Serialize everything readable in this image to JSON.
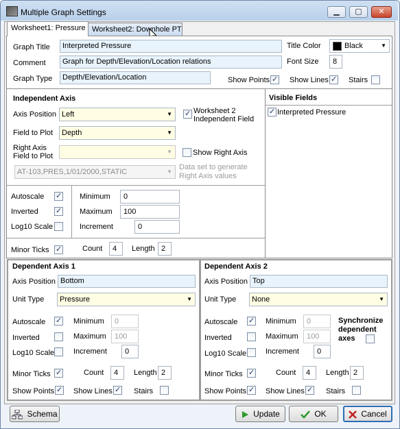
{
  "window": {
    "title": "Multiple Graph Settings",
    "min_label": "▁",
    "max_label": "▢",
    "close_label": "✕"
  },
  "tabs": [
    {
      "label": "Worksheet1: Pressure"
    },
    {
      "label": "Worksheet2: Downhole PT"
    }
  ],
  "graph": {
    "title_label": "Graph Title",
    "title_value": "Interpreted Pressure",
    "comment_label": "Comment",
    "comment_value": "Graph for Depth/Elevation/Location relations",
    "type_label": "Graph Type",
    "type_value": "Depth/Elevation/Location",
    "title_color_label": "Title Color",
    "title_color_value": "Black",
    "title_color_hex": "#000000",
    "font_size_label": "Font Size",
    "font_size_value": "8",
    "show_points_label": "Show Points",
    "show_points": true,
    "show_lines_label": "Show Lines",
    "show_lines": true,
    "stairs_label": "Stairs",
    "stairs": false
  },
  "independent_axis": {
    "heading": "Independent Axis",
    "position_label": "Axis Position",
    "position_value": "Left",
    "ws2_label_1": "Worksheet 2",
    "ws2_label_2": "Independent Field",
    "ws2_checked": true,
    "field_label": "Field to Plot",
    "field_value": "Depth",
    "right_field_label_1": "Right Axis",
    "right_field_label_2": "Field to Plot",
    "right_field_value": "",
    "show_right_label": "Show Right Axis",
    "show_right": false,
    "dataset_value": "AT-103,PRES,1/01/2000,STATIC",
    "dataset_note_1": "Data set to generate",
    "dataset_note_2": "Right Axis values",
    "autoscale_label": "Autoscale",
    "autoscale": true,
    "inverted_label": "Inverted",
    "inverted": true,
    "log_label": "Log10 Scale",
    "log": false,
    "min_label": "Minimum",
    "min_value": "0",
    "max_label": "Maximum",
    "max_value": "100",
    "inc_label": "Increment",
    "inc_value": "0",
    "minor_label": "Minor Ticks",
    "minor": true,
    "count_label": "Count",
    "count_value": "4",
    "length_label": "Length",
    "length_value": "2"
  },
  "visible_fields": {
    "heading": "Visible Fields",
    "items": [
      {
        "label": "Interpreted Pressure",
        "checked": true
      }
    ]
  },
  "dep1": {
    "heading": "Dependent Axis 1",
    "position_label": "Axis Position",
    "position_value": "Bottom",
    "unit_label": "Unit Type",
    "unit_value": "Pressure",
    "autoscale_label": "Autoscale",
    "autoscale": true,
    "inverted_label": "Inverted",
    "inverted": false,
    "log_label": "Log10 Scale",
    "log": false,
    "min_label": "Minimum",
    "min_value": "0",
    "max_label": "Maximum",
    "max_value": "100",
    "inc_label": "Increment",
    "inc_value": "0",
    "minor_label": "Minor Ticks",
    "minor": true,
    "count_label": "Count",
    "count_value": "4",
    "length_label": "Length",
    "length_value": "2",
    "show_points_label": "Show Points",
    "show_points": true,
    "show_lines_label": "Show Lines",
    "show_lines": true,
    "stairs_label": "Stairs",
    "stairs": false
  },
  "dep2": {
    "heading": "Dependent Axis 2",
    "position_label": "Axis Position",
    "position_value": "Top",
    "unit_label": "Unit Type",
    "unit_value": "None",
    "autoscale_label": "Autoscale",
    "autoscale": true,
    "inverted_label": "Inverted",
    "inverted": false,
    "log_label": "Log10 Scale",
    "log": false,
    "min_label": "Minimum",
    "min_value": "0",
    "max_label": "Maximum",
    "max_value": "100",
    "inc_label": "Increment",
    "inc_value": "0",
    "sync_label_1": "Synchronize",
    "sync_label_2": "dependent",
    "sync_label_3": "axes",
    "sync": false,
    "minor_label": "Minor Ticks",
    "minor": true,
    "count_label": "Count",
    "count_value": "4",
    "length_label": "Length",
    "length_value": "2",
    "show_points_label": "Show Points",
    "show_points": true,
    "show_lines_label": "Show Lines",
    "show_lines": true,
    "stairs_label": "Stairs",
    "stairs": false
  },
  "buttons": {
    "schema": "Schema",
    "update": "Update",
    "ok": "OK",
    "cancel": "Cancel"
  },
  "colors": {
    "update_icon": "#2e9a2e",
    "ok_icon": "#2e9a2e",
    "cancel_icon": "#c0201a",
    "field_bg": "#e8f3fc",
    "combo_bg": "#fffde3"
  }
}
